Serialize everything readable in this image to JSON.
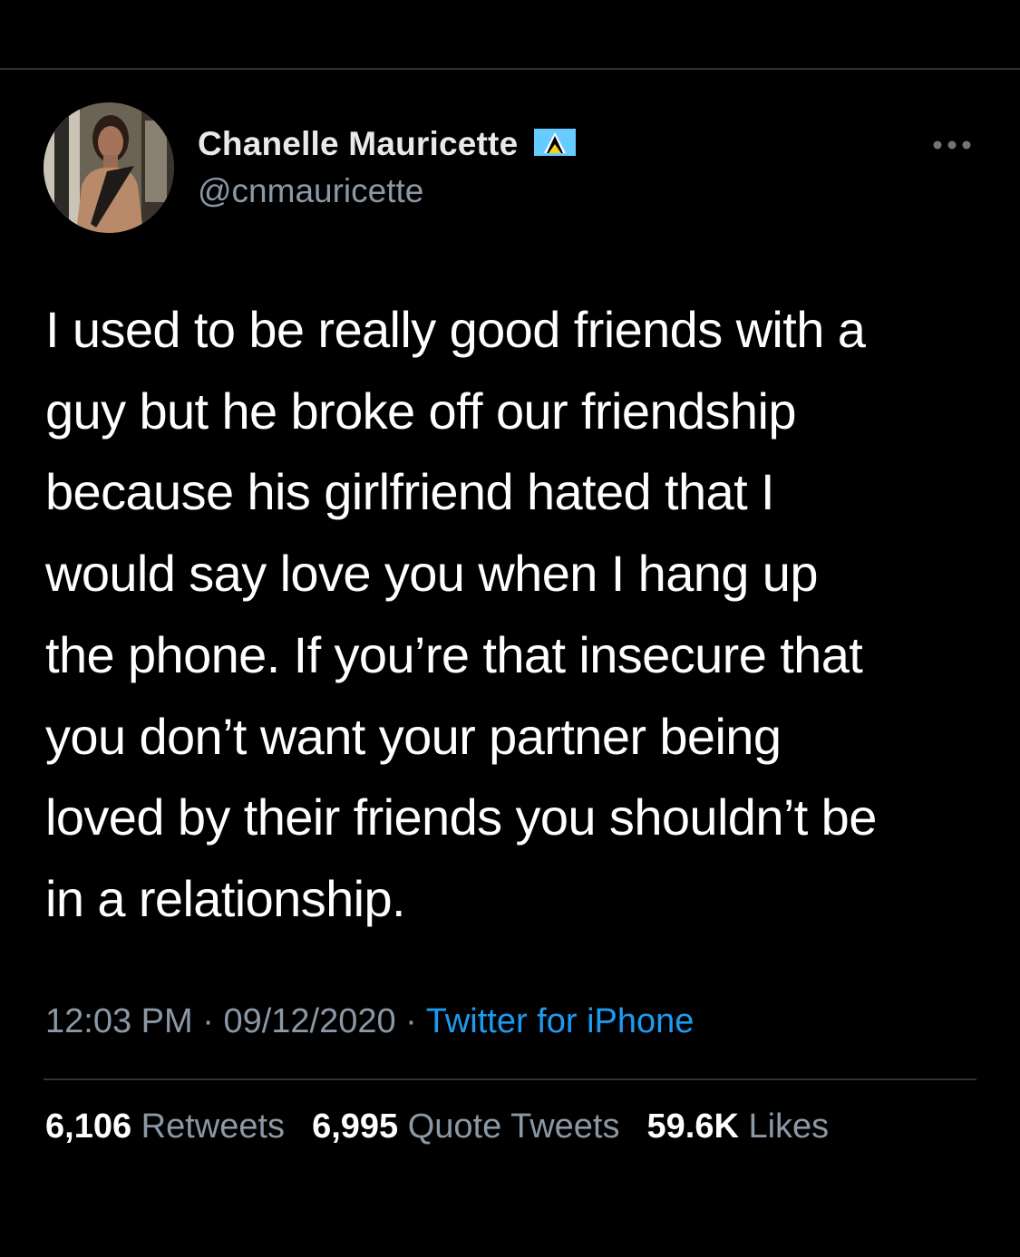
{
  "author": {
    "display_name": "Chanelle Mauricette",
    "handle": "@cnmauricette",
    "flag_icon": "saint-lucia-flag-icon"
  },
  "tweet": {
    "text": "I used to be really good friends with a\nguy but he broke off our friendship\nbecause his girlfriend hated that I\nwould say love you when I hang up\nthe phone. If you’re that insecure that\nyou don’t want your partner being\nloved by their friends you shouldn’t be\nin a relationship."
  },
  "meta": {
    "time": "12:03 PM",
    "separator": " · ",
    "date": "09/12/2020",
    "source": "Twitter for iPhone"
  },
  "stats": {
    "retweets_count": "6,106",
    "retweets_label": "Retweets",
    "quotes_count": "6,995",
    "quotes_label": "Quote Tweets",
    "likes_count": "59.6K",
    "likes_label": "Likes"
  },
  "colors": {
    "background": "#000000",
    "text_primary": "#ffffff",
    "text_secondary": "#8b98a5",
    "link": "#1d9bf0",
    "divider": "#2f3336"
  },
  "icons": {
    "more": "more-options-icon",
    "avatar": "avatar"
  }
}
